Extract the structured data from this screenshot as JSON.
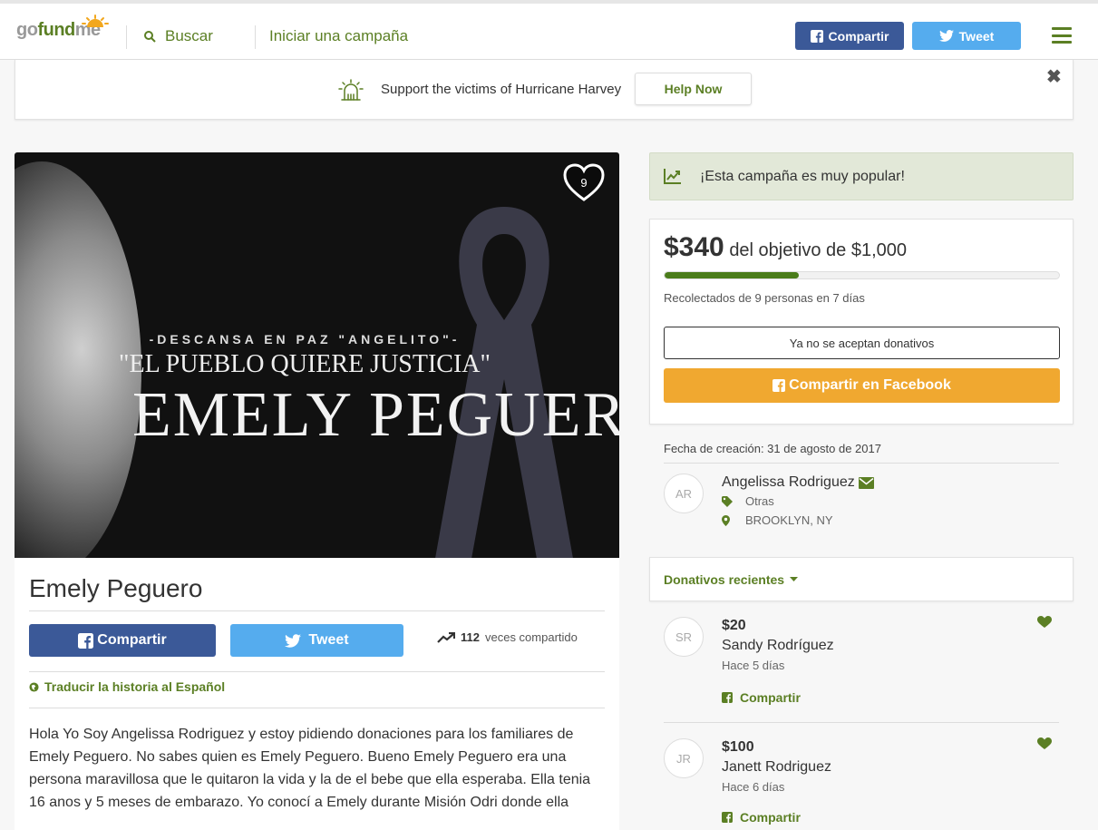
{
  "header": {
    "logo_part1": "go",
    "logo_part2": "fund",
    "logo_part3": "me",
    "search_label": "Buscar",
    "start_campaign": "Iniciar una campaña",
    "facebook_share": "Compartir",
    "tweet": "Tweet"
  },
  "banner": {
    "text": "Support the victims of Hurricane Harvey",
    "button": "Help Now",
    "close": "✖"
  },
  "hero": {
    "line1": "-DESCANSA EN PAZ \"ANGELITO\"-",
    "line2": "\"EL PUEBLO QUIERE JUSTICIA\"",
    "line3": "EMELY PEGUER",
    "hearts": "9"
  },
  "campaign": {
    "title": "Emely Peguero",
    "share_button": "Compartir",
    "tweet_button": "Tweet",
    "share_count": "112",
    "share_count_label": "veces compartido",
    "translate_label": "Traducir la historia al Español",
    "story": "Hola Yo Soy Angelissa Rodriguez y estoy pidiendo donaciones para los familiares de Emely Peguero. No sabes quien es Emely Peguero. Bueno Emely Peguero era una persona maravillosa que le quitaron la vida y la de el bebe que ella esperaba. Ella tenia 16 anos y 5 meses de embarazo. Yo conocí a Emely durante Misión Odri donde ella"
  },
  "sidebar": {
    "popular_text": "¡Esta campaña es muy popular!",
    "raised_amount": "$340",
    "goal_text": "del objetivo de $1,000",
    "progress_fraction": 0.34,
    "collected_text": "Recolectados de 9 personas en 7 días",
    "closed_button": "Ya no se aceptan donativos",
    "facebook_share_button": "Compartir en Facebook",
    "created_label": "Fecha de creación: 31 de agosto de 2017",
    "organizer_initials": "AR",
    "organizer_name": "Angelissa Rodriguez",
    "category": "Otras",
    "location": "BROOKLYN, NY",
    "recent_label": "Donativos recientes",
    "donations": [
      {
        "initials": "SR",
        "amount": "$20",
        "name": "Sandy Rodríguez",
        "time": "Hace 5 días",
        "share": "Compartir"
      },
      {
        "initials": "JR",
        "amount": "$100",
        "name": "Janett Rodriguez",
        "time": "Hace 6 días",
        "share": "Compartir"
      }
    ]
  },
  "colors": {
    "brand_green": "#5b7f24",
    "facebook": "#3b5998",
    "twitter": "#55acee",
    "orange": "#f0a830",
    "progress": "#4a7c1a"
  }
}
